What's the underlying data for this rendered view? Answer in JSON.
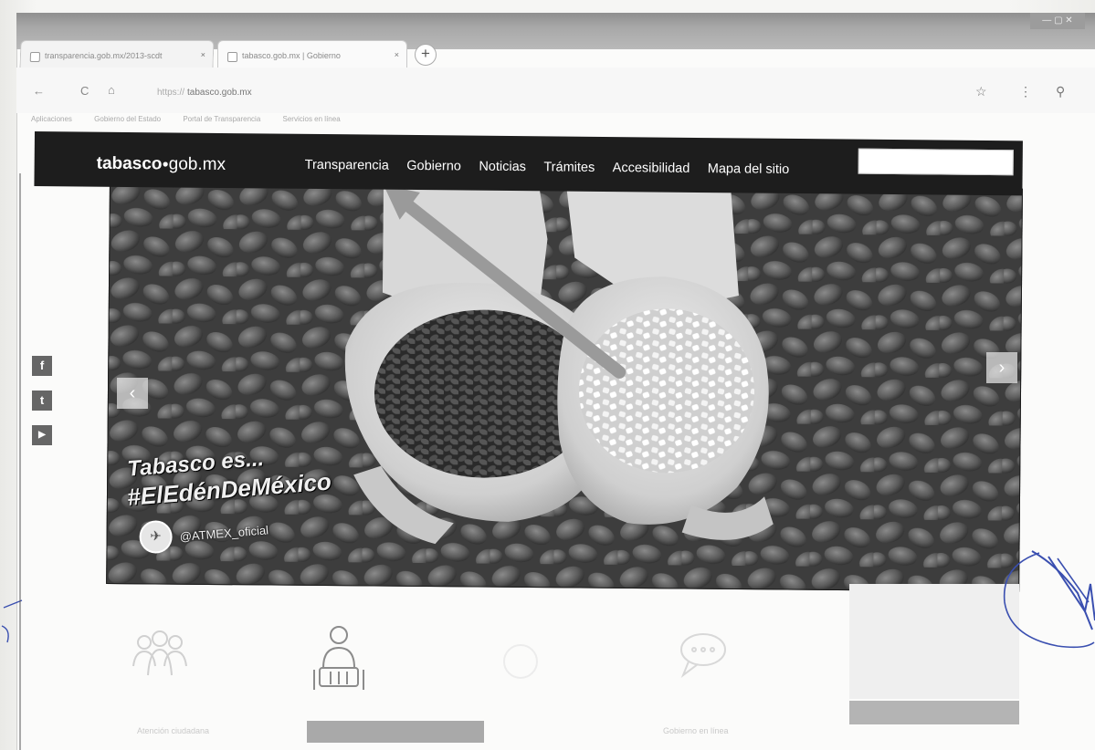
{
  "browser": {
    "tabs": [
      {
        "title": "transparencia.gob.mx/2013-scdt",
        "close": "×"
      },
      {
        "title": "tabasco.gob.mx | Gobierno",
        "close": "×"
      }
    ],
    "new_tab": "+",
    "url_prefix": "https://",
    "url": "tabasco.gob.mx",
    "back_icon": "←",
    "reload_icon": "C",
    "home_icon": "⌂",
    "star_icon": "☆",
    "menu_icon": "⋮",
    "profile_icon": "⚲",
    "bookmarks": [
      "Aplicaciones",
      "Gobierno del Estado",
      "Portal de Transparencia",
      "Servicios en línea"
    ]
  },
  "site": {
    "logo_bold": "tabasco",
    "logo_dot": "●",
    "logo_rest": "gob.mx",
    "nav": [
      "Transparencia",
      "Gobierno",
      "Noticias",
      "Trámites",
      "Accesibilidad",
      "Mapa del sitio"
    ]
  },
  "hero": {
    "line1": "Tabasco es...",
    "line2": "#ElEdénDeMéxico",
    "handle": "@ATMEX_oficial",
    "prev": "‹",
    "next": "›"
  },
  "social": [
    "f",
    "t",
    "▶"
  ],
  "services": [
    {
      "icon": "people-icon",
      "label": "Atención ciudadana"
    },
    {
      "icon": "person-icon",
      "label": ""
    },
    {
      "icon": "blank-icon",
      "label": ""
    },
    {
      "icon": "chat-icon",
      "label": "Gobierno en línea"
    },
    {
      "icon": "headset-icon",
      "label": ""
    }
  ],
  "colors": {
    "header_bg": "#1d1d1d",
    "arrow_annotation": "#9a9a9a",
    "pen_ink": "#3a4fb0"
  }
}
